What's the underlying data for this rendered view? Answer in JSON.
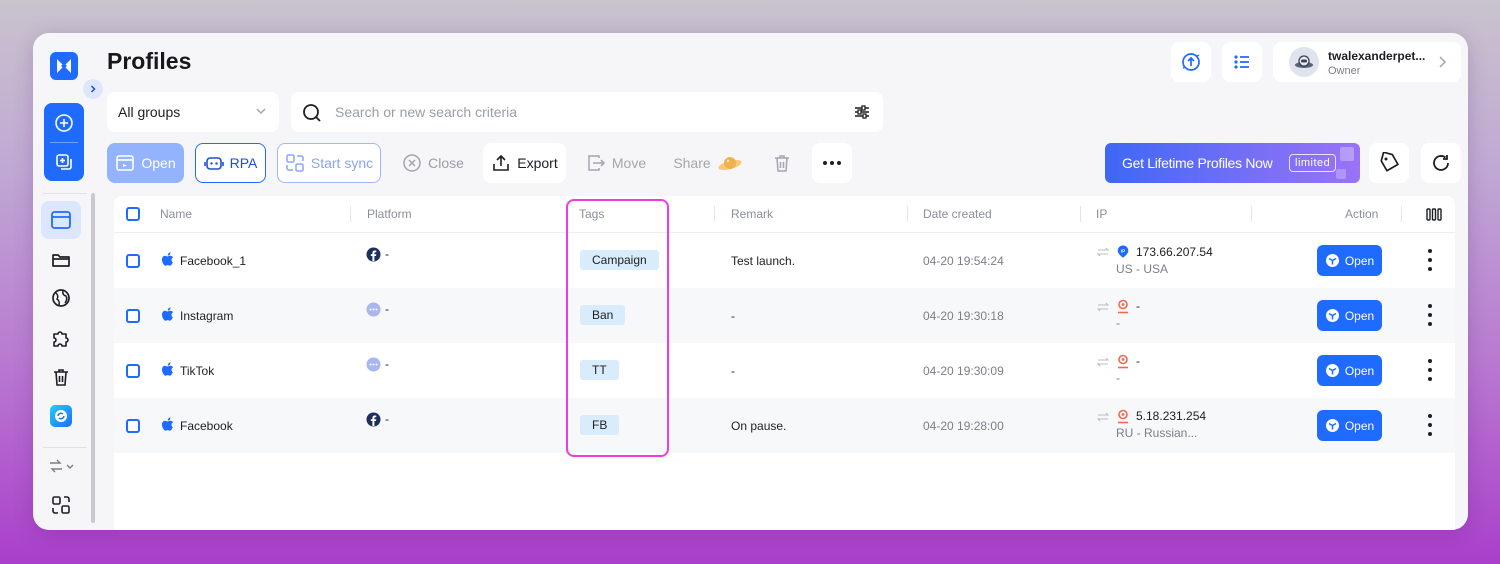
{
  "header": {
    "title": "Profiles",
    "user_name": "twalexanderpet...",
    "user_role": "Owner"
  },
  "filters": {
    "group": "All groups",
    "search_placeholder": "Search or new search criteria"
  },
  "toolbar": {
    "open": "Open",
    "rpa": "RPA",
    "start_sync": "Start sync",
    "close": "Close",
    "export": "Export",
    "move": "Move",
    "share": "Share",
    "promo_text": "Get Lifetime Profiles Now",
    "promo_badge": "limited"
  },
  "table": {
    "columns": [
      "Name",
      "Platform",
      "Tags",
      "Remark",
      "Date created",
      "IP",
      "Action"
    ],
    "open_label": "Open",
    "rows": [
      {
        "name": "Facebook_1",
        "platform": "facebook",
        "platform_text": "-",
        "tag": "Campaign",
        "remark": "Test launch.",
        "date": "04-20 19:54:24",
        "ip": "173.66.207.54",
        "ip_region": "US - USA",
        "ip_icon": "ip-badge"
      },
      {
        "name": "Instagram",
        "platform": "other",
        "platform_text": "-",
        "tag": "Ban",
        "remark": "-",
        "date": "04-20 19:30:18",
        "ip": "-",
        "ip_region": "-",
        "ip_icon": "location-pin"
      },
      {
        "name": "TikTok",
        "platform": "other",
        "platform_text": "-",
        "tag": "TT",
        "remark": "-",
        "date": "04-20 19:30:09",
        "ip": "-",
        "ip_region": "-",
        "ip_icon": "location-pin"
      },
      {
        "name": "Facebook",
        "platform": "facebook",
        "platform_text": "-",
        "tag": "FB",
        "remark": "On pause.",
        "date": "04-20 19:28:00",
        "ip": "5.18.231.254",
        "ip_region": "RU - Russian...",
        "ip_icon": "location-pin"
      }
    ]
  },
  "colors": {
    "accent": "#1f6bff",
    "tag_bg": "#d8ecfb",
    "highlight": "#ee3dde",
    "location_pin": "#f06a4a"
  }
}
